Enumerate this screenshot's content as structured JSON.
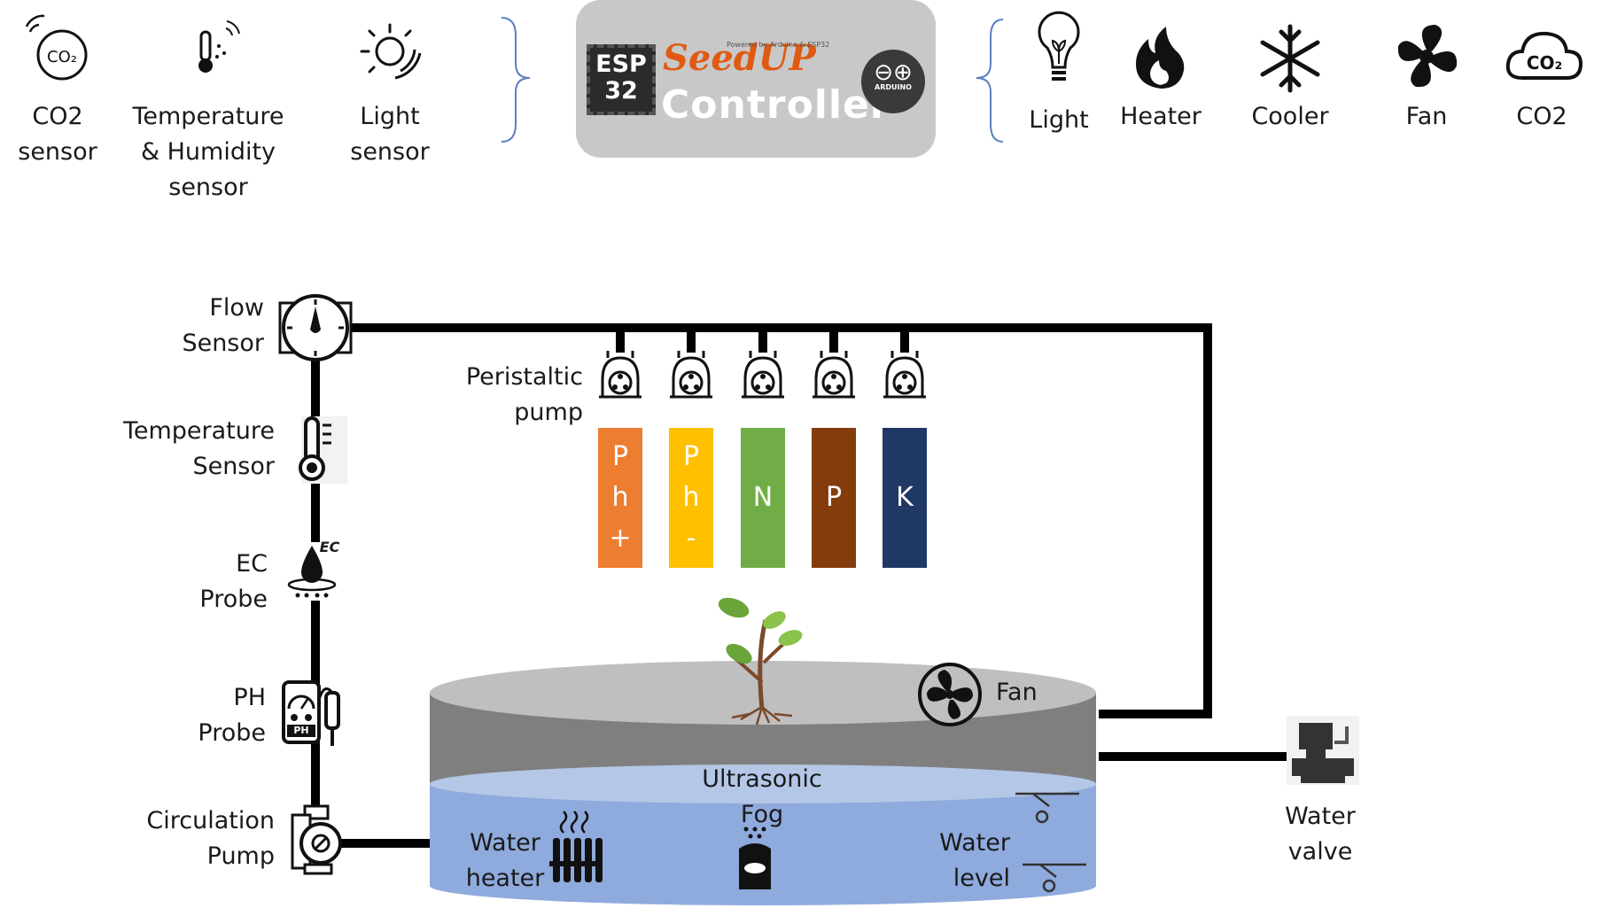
{
  "sensors": [
    {
      "label": "CO2\nsensor",
      "icon": "co2-sensor-icon"
    },
    {
      "label": "Temperature\n& Humidity\nsensor",
      "icon": "thermometer-humidity-icon"
    },
    {
      "label": "Light\nsensor",
      "icon": "sun-icon"
    }
  ],
  "controller": {
    "chip": "ESP\n32",
    "brand": "SeedUP",
    "brand_sub": "Powered by Arduino & ESP32",
    "title": "Controller",
    "arduino": "ARDUINO"
  },
  "actuators": [
    {
      "label": "Light",
      "icon": "light-bulb-icon"
    },
    {
      "label": "Heater",
      "icon": "flame-icon"
    },
    {
      "label": "Cooler",
      "icon": "snowflake-icon"
    },
    {
      "label": "Fan",
      "icon": "fan-icon"
    },
    {
      "label": "CO2",
      "icon": "co2-cloud-icon"
    }
  ],
  "pipeline": {
    "flow_sensor": "Flow\nSensor",
    "temperature_sensor": "Temperature\nSensor",
    "ec_probe": "EC\nProbe",
    "ec_badge": "EC",
    "ph_probe": "PH\nProbe",
    "ph_badge": "PH",
    "circulation_pump": "Circulation\nPump"
  },
  "peristaltic_label": "Peristaltic\npump",
  "nutrients": [
    {
      "text": "P\nh\n+",
      "color": "#ed7d31"
    },
    {
      "text": "P\nh\n-",
      "color": "#ffc000"
    },
    {
      "text": "N",
      "color": "#70ad47"
    },
    {
      "text": "P",
      "color": "#843c0c"
    },
    {
      "text": "K",
      "color": "#203864"
    }
  ],
  "tank": {
    "fan": "Fan",
    "ultrasonic_fog": "Ultrasonic\nFog",
    "water_heater": "Water\nheater",
    "water_level": "Water\nlevel"
  },
  "water_valve": "Water\nvalve",
  "colors": {
    "controller_bg": "#c8c8c8",
    "tank_top": "#c0c0c0",
    "tank_wall": "#7f7f7f",
    "water": "#8faadc",
    "water_surface": "#b4c7e7",
    "pipe": "#000000",
    "bracket": "#5b7fbf"
  }
}
